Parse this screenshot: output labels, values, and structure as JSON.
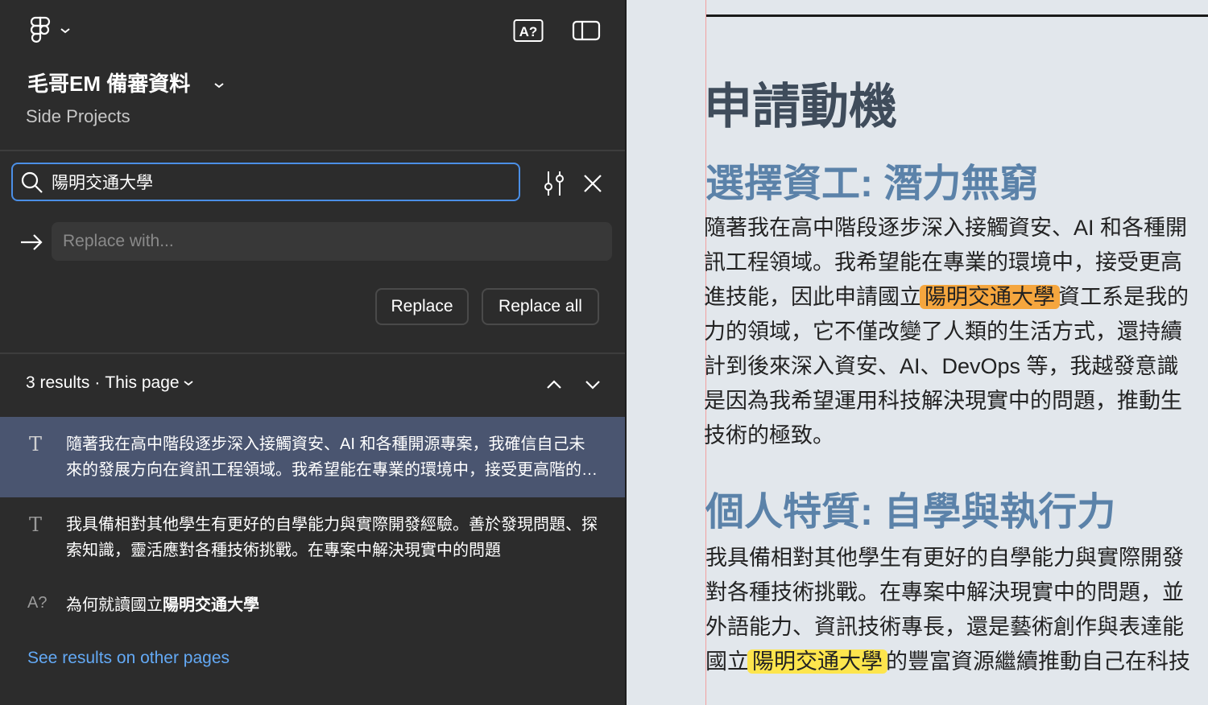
{
  "panel": {
    "title": "毛哥EM 備審資料",
    "project": "Side Projects",
    "search": {
      "value": "陽明交通大學"
    },
    "replace": {
      "placeholder": "Replace with..."
    },
    "buttons": {
      "replace": "Replace",
      "replace_all": "Replace all"
    },
    "results": {
      "count": "3 results",
      "separator": "·",
      "scope": "This page",
      "items": [
        {
          "type_icon": "T",
          "text": "隨著我在高中階段逐步深入接觸資安、AI 和各種開源專案，我確信自己未來的發展方向在資訊工程領域。我希望能在專業的環境中，接受更高階的知識與先進技能"
        },
        {
          "type_icon": "T",
          "text": "我具備相對其他學生有更好的自學能力與實際開發經驗。善於發現問題、探索知識，靈活應對各種技術挑戰。在專案中解決現實中的問題"
        },
        {
          "type_icon": "A?",
          "text_prefix": "為何就讀國立",
          "text_match": "陽明交通大學"
        }
      ]
    },
    "see_other_pages": "See results on other pages"
  },
  "document": {
    "heading": "申請動機",
    "section1": {
      "title": "選擇資工: 潛力無窮",
      "lines": [
        {
          "text": "隨著我在高中階段逐步深入接觸資安、AI 和各種開"
        },
        {
          "text": "訊工程領域。我希望能在專業的環境中，接受更高"
        },
        {
          "before": "進技能，因此申請國立",
          "match": "陽明交通大學",
          "after": "資工系是我的"
        },
        {
          "text": "力的領域，它不僅改變了人類的生活方式，還持續"
        },
        {
          "text": "計到後來深入資安、AI、DevOps 等，我越發意識"
        },
        {
          "text": "是因為我希望運用科技解決現實中的問題，推動生"
        },
        {
          "text": "技術的極致。"
        }
      ]
    },
    "section2": {
      "title": "個人特質: 自學與執行力",
      "lines": [
        {
          "text": "我具備相對其他學生有更好的自學能力與實際開發"
        },
        {
          "text": "對各種技術挑戰。在專案中解決現實中的問題，並"
        },
        {
          "text": "外語能力、資訊技術專長，還是藝術創作與表達能"
        },
        {
          "before": "國立",
          "match": "陽明交通大學",
          "after": "的豐富資源繼續推動自己在科技"
        }
      ]
    }
  },
  "colors": {
    "panel_bg": "#2c2c2c",
    "focus_border": "#4b8fe6",
    "active_result": "#4a5570",
    "link": "#63a9f5",
    "highlight_current": "#f5a63e",
    "highlight_other": "#fde54d",
    "heading_blue": "#5b82a9",
    "doc_bg": "#e2e7ec"
  },
  "icons": {
    "figma_menu": "figma-logo-icon",
    "font_check": "missing-font-icon",
    "sidebar_toggle": "sidebar-icon",
    "search": "search-icon",
    "filters": "sliders-icon",
    "close": "close-icon",
    "replace_arrow": "arrow-right-icon",
    "prev": "chevron-up-icon",
    "next": "chevron-down-icon"
  }
}
